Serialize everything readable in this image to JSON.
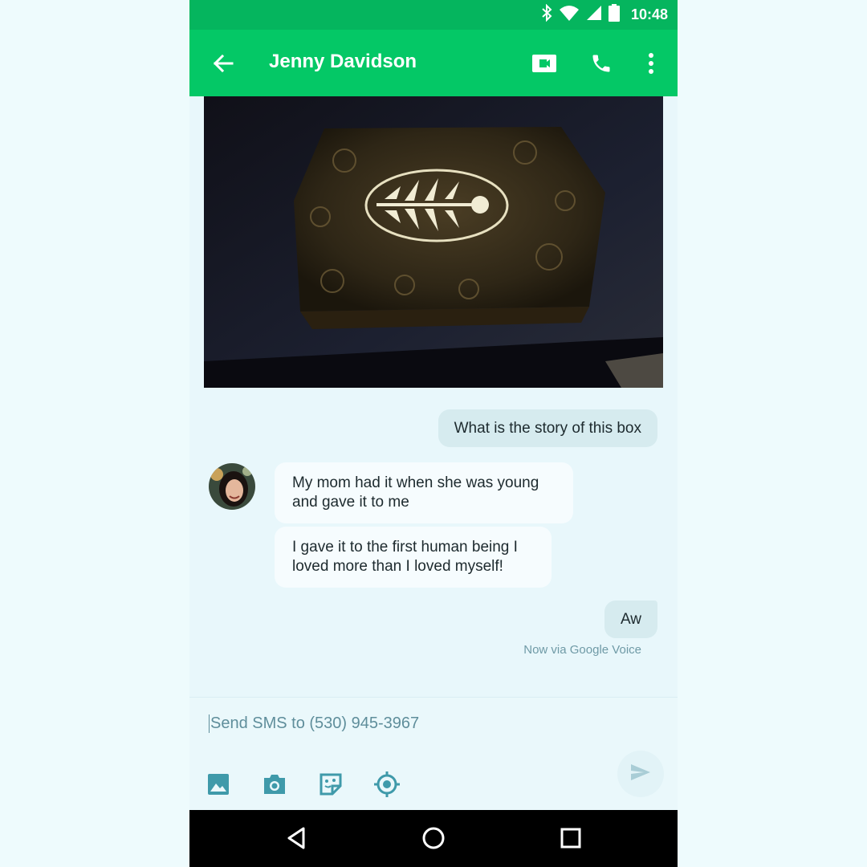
{
  "status_bar": {
    "time": "10:48",
    "icons": [
      "bluetooth-icon",
      "wifi-icon",
      "signal-icon",
      "battery-icon"
    ]
  },
  "app_bar": {
    "title": "Jenny Davidson",
    "actions": [
      "back-arrow-icon",
      "video-call-icon",
      "phone-icon",
      "more-vert-icon"
    ],
    "color": "#04c866"
  },
  "conversation": {
    "messages": [
      {
        "direction": "outgoing",
        "text": "What is the story of this box"
      },
      {
        "direction": "incoming",
        "text": "My mom had it when she was young and gave it to me"
      },
      {
        "direction": "incoming",
        "text": "I gave it to the first human being I loved more than I loved myself!"
      },
      {
        "direction": "outgoing",
        "text": "Aw"
      }
    ],
    "last_status": "Now via Google Voice"
  },
  "composer": {
    "placeholder": "Send SMS to (530) 945-3967",
    "tools": [
      "image-icon",
      "camera-icon",
      "sticker-icon",
      "location-icon"
    ],
    "send_icon": "send-icon"
  },
  "nav_bar": {
    "buttons": [
      "back-triangle-icon",
      "home-circle-icon",
      "recents-square-icon"
    ]
  },
  "colors": {
    "accent": "#04c866",
    "status_bar": "#05b55e",
    "icon_teal": "#3f9aaa",
    "outgoing_bubble": "#d6ebef",
    "incoming_bubble": "#f6fcfe"
  }
}
